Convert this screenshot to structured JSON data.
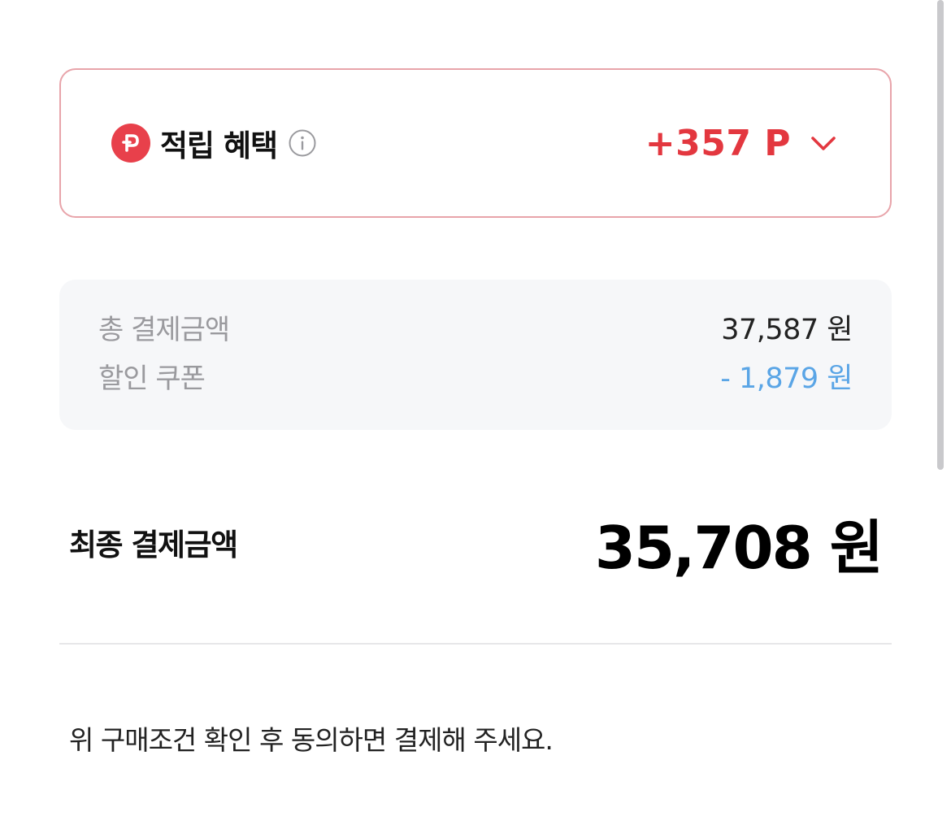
{
  "reward": {
    "title": "적립 혜택",
    "amount": "+357 P",
    "icons": {
      "point": "point-coin-icon",
      "info": "info-icon",
      "expand": "chevron-down-icon"
    },
    "colors": {
      "accent": "#e3373f",
      "border": "#e8a4aa"
    }
  },
  "summary": {
    "total_label": "총 결제금액",
    "total_value": "37,587 원",
    "coupon_label": "할인 쿠폰",
    "coupon_value": "- 1,879 원",
    "colors": {
      "discount": "#5aa5e6"
    }
  },
  "final": {
    "label": "최종 결제금액",
    "amount": "35,708 원"
  },
  "agreement": {
    "text": "위 구매조건 확인 후 동의하면 결제해 주세요."
  }
}
